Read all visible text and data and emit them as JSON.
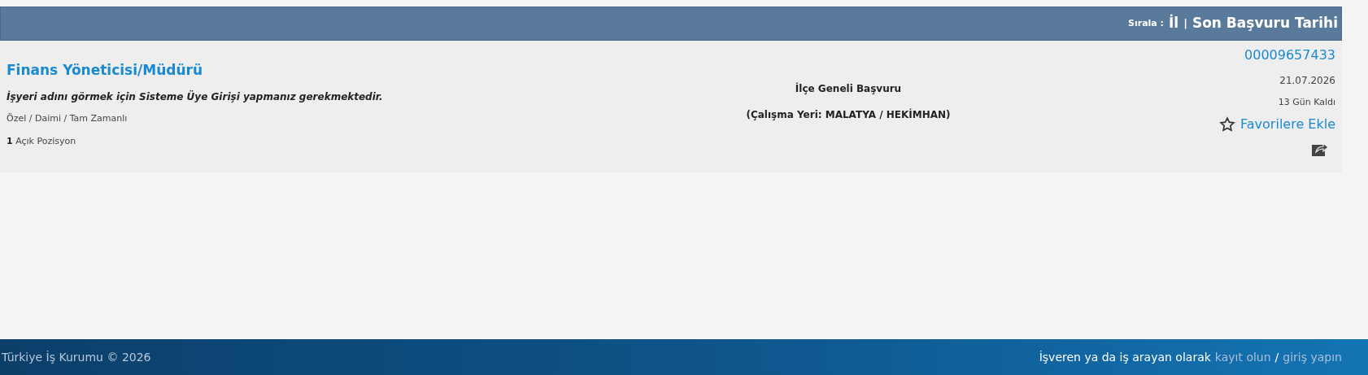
{
  "sort_bar": {
    "label": "Sırala :",
    "separator": "|",
    "options": [
      {
        "label": "İl"
      },
      {
        "label": "Son Başvuru Tarihi"
      }
    ]
  },
  "listing": {
    "title": "Finans Yöneticisi/Müdürü",
    "notice": "İşyeri adını görmek için Sisteme Üye Girişi yapmanız gerekmektedir.",
    "type": "Özel / Daimi / Tam Zamanlı",
    "positions_count": "1",
    "positions_label": "Açık Pozisyon",
    "scope": "İlçe Geneli Başvuru",
    "location": "(Çalışma Yeri: MALATYA / HEKİMHAN)",
    "number": "00009657433",
    "deadline": "21.07.2026",
    "remaining": "13 Gün Kaldı",
    "favorite": "Favorilere Ekle"
  },
  "footer": {
    "copyright": "Türkiye İş Kurumu © 2026",
    "prompt": "İşveren ya da iş arayan olarak",
    "separator": "/",
    "links": [
      "kayıt olun",
      "giriş yapın"
    ]
  }
}
